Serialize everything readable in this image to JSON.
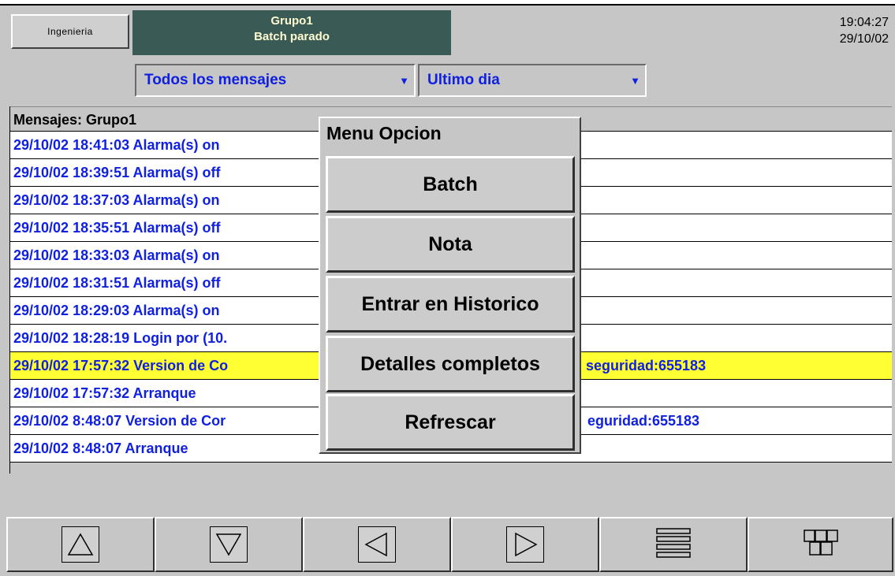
{
  "header": {
    "mode_button": "Ingenieria",
    "group_name": "Grupo1",
    "batch_status": "Batch parado",
    "time": "19:04:27",
    "date": "29/10/02"
  },
  "filters": {
    "message_type": "Todos los mensajes",
    "period": "Ultimo dia"
  },
  "messages": {
    "header": "Mensajes: Grupo1",
    "rows": [
      "29/10/02 18:41:03 Alarma(s) on",
      "29/10/02 18:39:51 Alarma(s) off",
      "29/10/02 18:37:03 Alarma(s) on",
      "29/10/02 18:35:51 Alarma(s) off",
      "29/10/02 18:33:03 Alarma(s) on",
      "29/10/02 18:31:51 Alarma(s) off",
      "29/10/02 18:29:03 Alarma(s) on",
      "29/10/02 18:28:19 Login por (10.",
      "29/10/02 17:57:32 Version de Co",
      "29/10/02 17:57:32 Arranque",
      "29/10/02 8:48:07 Version de Cor",
      "29/10/02 8:48:07 Arranque"
    ],
    "row8_tail": "seguridad:655183",
    "row10_tail": "eguridad:655183",
    "highlight_color": "#ffff33",
    "text_color": "#1020e0"
  },
  "menu": {
    "title": "Menu Opcion",
    "items": [
      "Batch",
      "Nota",
      "Entrar en Historico",
      "Detalles completos",
      "Refrescar"
    ]
  },
  "nav": {
    "icons": [
      "triangle-up-icon",
      "triangle-down-icon",
      "triangle-left-icon",
      "triangle-right-icon",
      "menu-lines-icon",
      "grid-blocks-icon"
    ]
  }
}
